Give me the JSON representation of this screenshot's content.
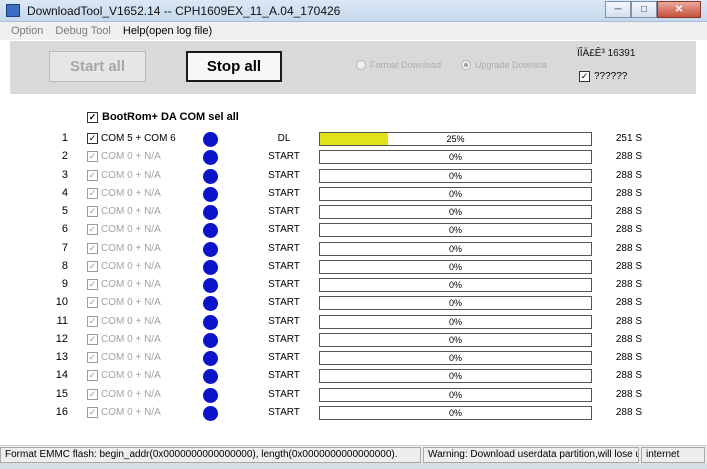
{
  "window": {
    "title": "DownloadTool_V1652.14 -- CPH1609EX_11_A.04_170426"
  },
  "menu": [
    {
      "label": "Option",
      "enabled": false
    },
    {
      "label": "Debug Tool",
      "enabled": false
    },
    {
      "label": "Help(open log file)",
      "enabled": true
    }
  ],
  "toolbar": {
    "start_label": "Start all",
    "stop_label": "Stop all",
    "radio_format": "Format Download",
    "radio_upgrade": "Upgrade Downloa",
    "counter": "ÏÎÄ£Ê³ 16391",
    "check_label": "??????"
  },
  "select_all_label": "BootRom+ DA COM sel all",
  "ports": [
    {
      "index": "1",
      "com": "COM 5 + COM 6",
      "active": true,
      "state": "DL",
      "progress_text": "25%",
      "progress_fraction": 0.25,
      "time": "251 S"
    },
    {
      "index": "2",
      "com": "COM 0 + N/A",
      "active": false,
      "state": "START",
      "progress_text": "0%",
      "progress_fraction": 0,
      "time": "288 S"
    },
    {
      "index": "3",
      "com": "COM 0 + N/A",
      "active": false,
      "state": "START",
      "progress_text": "0%",
      "progress_fraction": 0,
      "time": "288 S"
    },
    {
      "index": "4",
      "com": "COM 0 + N/A",
      "active": false,
      "state": "START",
      "progress_text": "0%",
      "progress_fraction": 0,
      "time": "288 S"
    },
    {
      "index": "5",
      "com": "COM 0 + N/A",
      "active": false,
      "state": "START",
      "progress_text": "0%",
      "progress_fraction": 0,
      "time": "288 S"
    },
    {
      "index": "6",
      "com": "COM 0 + N/A",
      "active": false,
      "state": "START",
      "progress_text": "0%",
      "progress_fraction": 0,
      "time": "288 S"
    },
    {
      "index": "7",
      "com": "COM 0 + N/A",
      "active": false,
      "state": "START",
      "progress_text": "0%",
      "progress_fraction": 0,
      "time": "288 S"
    },
    {
      "index": "8",
      "com": "COM 0 + N/A",
      "active": false,
      "state": "START",
      "progress_text": "0%",
      "progress_fraction": 0,
      "time": "288 S"
    },
    {
      "index": "9",
      "com": "COM 0 + N/A",
      "active": false,
      "state": "START",
      "progress_text": "0%",
      "progress_fraction": 0,
      "time": "288 S"
    },
    {
      "index": "10",
      "com": "COM 0 + N/A",
      "active": false,
      "state": "START",
      "progress_text": "0%",
      "progress_fraction": 0,
      "time": "288 S"
    },
    {
      "index": "11",
      "com": "COM 0 + N/A",
      "active": false,
      "state": "START",
      "progress_text": "0%",
      "progress_fraction": 0,
      "time": "288 S"
    },
    {
      "index": "12",
      "com": "COM 0 + N/A",
      "active": false,
      "state": "START",
      "progress_text": "0%",
      "progress_fraction": 0,
      "time": "288 S"
    },
    {
      "index": "13",
      "com": "COM 0 + N/A",
      "active": false,
      "state": "START",
      "progress_text": "0%",
      "progress_fraction": 0,
      "time": "288 S"
    },
    {
      "index": "14",
      "com": "COM 0 + N/A",
      "active": false,
      "state": "START",
      "progress_text": "0%",
      "progress_fraction": 0,
      "time": "288 S"
    },
    {
      "index": "15",
      "com": "COM 0 + N/A",
      "active": false,
      "state": "START",
      "progress_text": "0%",
      "progress_fraction": 0,
      "time": "288 S"
    },
    {
      "index": "16",
      "com": "COM 0 + N/A",
      "active": false,
      "state": "START",
      "progress_text": "0%",
      "progress_fraction": 0,
      "time": "288 S"
    }
  ],
  "statusbar": {
    "left": "Format EMMC flash:  begin_addr(0x0000000000000000), length(0x0000000000000000).",
    "middle": "Warning: Download userdata partition,will lose u",
    "right": "internet"
  },
  "colors": {
    "led": "#0b14c9",
    "progress_fill": "#e1e11c"
  }
}
